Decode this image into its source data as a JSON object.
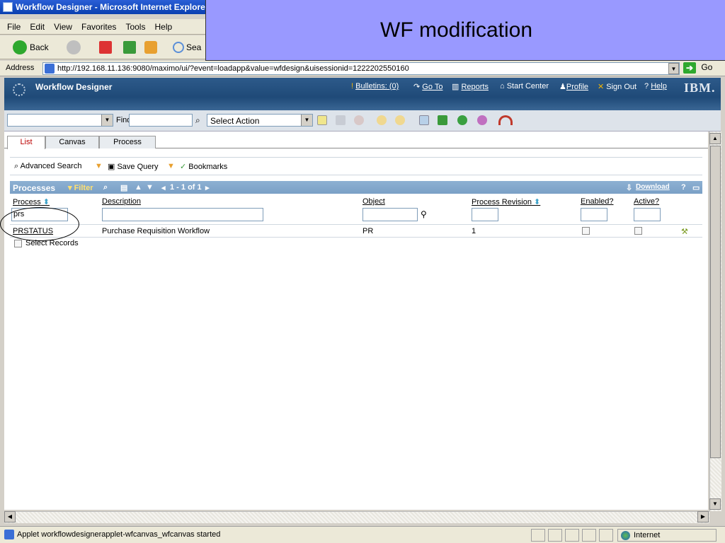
{
  "window": {
    "title": "Workflow Designer - Microsoft Internet Explore"
  },
  "overlay": {
    "title": "WF modification"
  },
  "menu": [
    "File",
    "Edit",
    "View",
    "Favorites",
    "Tools",
    "Help"
  ],
  "std_toolbar": {
    "back_label": "Back",
    "search_label": "Sea"
  },
  "address": {
    "label": "Address",
    "url": "http://192.168.11.136:9080/maximo/ui/?event=loadapp&value=wfdesign&uisessionid=1222202550160",
    "go_label": "Go"
  },
  "app": {
    "title": "Workflow Designer",
    "bulletins": "Bulletins: (0)",
    "goto": "Go To",
    "reports": "Reports",
    "start_center": "Start Center",
    "profile": "Profile",
    "sign_out": "Sign Out",
    "help": "Help",
    "brand": "IBM."
  },
  "toolbar": {
    "find_label": "Find:",
    "select_action": "Select Action"
  },
  "tabs": [
    "List",
    "Canvas",
    "Process"
  ],
  "subbar": {
    "advanced_search": "Advanced Search",
    "save_query": "Save Query",
    "bookmarks": "Bookmarks"
  },
  "table": {
    "title": "Processes",
    "filter_label": "Filter",
    "pager": "1 - 1 of 1",
    "download": "Download",
    "columns": [
      "Process",
      "Description",
      "Object",
      "Process Revision",
      "Enabled?",
      "Active?"
    ],
    "filters": {
      "process": "prs"
    },
    "rows": [
      {
        "process": "PRSTATUS",
        "description": "Purchase Requisition Workflow",
        "object": "PR",
        "revision": "1",
        "enabled": false,
        "active": false
      }
    ],
    "select_records": "Select Records"
  },
  "status": {
    "text": "Applet workflowdesignerapplet-wfcanvas_wfcanvas started",
    "zone": "Internet"
  },
  "colors": {
    "overlay": "#9999ff",
    "app_header": "#2d5a8a",
    "table_header": "#8db0d2"
  }
}
